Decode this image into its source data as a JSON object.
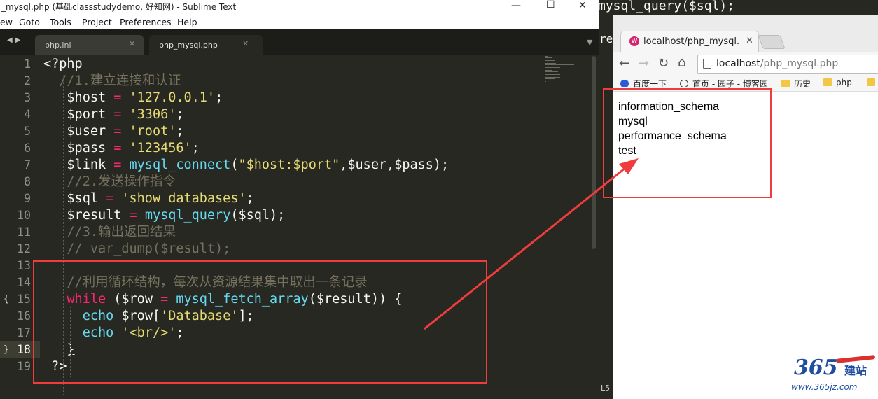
{
  "sublime": {
    "title": "_mysql.php (基础classstudydemo, 好知网) - Sublime Text",
    "menu": [
      "ew",
      "Goto",
      "Tools",
      "Project",
      "Preferences",
      "Help"
    ],
    "tabs": [
      {
        "label": "php.ini",
        "active": false
      },
      {
        "label": "php_mysql.php",
        "active": true
      }
    ],
    "current_line": 18,
    "lines": [
      {
        "n": "1",
        "tokens": [
          {
            "t": "<?php",
            "c": "plain"
          }
        ]
      },
      {
        "n": "2",
        "tokens": [
          {
            "t": "  //1.建立连接和认证",
            "c": "cm"
          }
        ]
      },
      {
        "n": "3",
        "tokens": [
          {
            "t": "   $host ",
            "c": "plain"
          },
          {
            "t": "=",
            "c": "kw"
          },
          {
            "t": " ",
            "c": "plain"
          },
          {
            "t": "'127.0.0.1'",
            "c": "str"
          },
          {
            "t": ";",
            "c": "plain"
          }
        ]
      },
      {
        "n": "4",
        "tokens": [
          {
            "t": "   $port ",
            "c": "plain"
          },
          {
            "t": "=",
            "c": "kw"
          },
          {
            "t": " ",
            "c": "plain"
          },
          {
            "t": "'3306'",
            "c": "str"
          },
          {
            "t": ";",
            "c": "plain"
          }
        ]
      },
      {
        "n": "5",
        "tokens": [
          {
            "t": "   $user ",
            "c": "plain"
          },
          {
            "t": "=",
            "c": "kw"
          },
          {
            "t": " ",
            "c": "plain"
          },
          {
            "t": "'root'",
            "c": "str"
          },
          {
            "t": ";",
            "c": "plain"
          }
        ]
      },
      {
        "n": "6",
        "tokens": [
          {
            "t": "   $pass ",
            "c": "plain"
          },
          {
            "t": "=",
            "c": "kw"
          },
          {
            "t": " ",
            "c": "plain"
          },
          {
            "t": "'123456'",
            "c": "str"
          },
          {
            "t": ";",
            "c": "plain"
          }
        ]
      },
      {
        "n": "7",
        "tokens": [
          {
            "t": "   $link ",
            "c": "plain"
          },
          {
            "t": "=",
            "c": "kw"
          },
          {
            "t": " ",
            "c": "plain"
          },
          {
            "t": "mysql_connect",
            "c": "fn"
          },
          {
            "t": "(",
            "c": "plain"
          },
          {
            "t": "\"$host:$port\"",
            "c": "str"
          },
          {
            "t": ",$user,$pass);",
            "c": "plain"
          }
        ]
      },
      {
        "n": "8",
        "tokens": [
          {
            "t": "   //2.发送操作指令",
            "c": "cm"
          }
        ]
      },
      {
        "n": "9",
        "tokens": [
          {
            "t": "   $sql ",
            "c": "plain"
          },
          {
            "t": "=",
            "c": "kw"
          },
          {
            "t": " ",
            "c": "plain"
          },
          {
            "t": "'show databases'",
            "c": "str"
          },
          {
            "t": ";",
            "c": "plain"
          }
        ]
      },
      {
        "n": "10",
        "tokens": [
          {
            "t": "   $result ",
            "c": "plain"
          },
          {
            "t": "=",
            "c": "kw"
          },
          {
            "t": " ",
            "c": "plain"
          },
          {
            "t": "mysql_query",
            "c": "fn"
          },
          {
            "t": "($sql);",
            "c": "plain"
          }
        ]
      },
      {
        "n": "11",
        "tokens": [
          {
            "t": "   //3.输出返回结果",
            "c": "cm"
          }
        ]
      },
      {
        "n": "12",
        "tokens": [
          {
            "t": "   // var_dump($result);",
            "c": "cm"
          }
        ]
      },
      {
        "n": "13",
        "tokens": []
      },
      {
        "n": "14",
        "tokens": [
          {
            "t": "   //利用循环结构，每次从资源结果集中取出一条记录",
            "c": "cm"
          }
        ]
      },
      {
        "n": "15",
        "tokens": [
          {
            "t": "   ",
            "c": "plain"
          },
          {
            "t": "while",
            "c": "kw"
          },
          {
            "t": " ($row ",
            "c": "plain"
          },
          {
            "t": "=",
            "c": "kw"
          },
          {
            "t": " ",
            "c": "plain"
          },
          {
            "t": "mysql_fetch_array",
            "c": "fn"
          },
          {
            "t": "($result)) ",
            "c": "plain"
          },
          {
            "t": "{",
            "c": "ul"
          }
        ]
      },
      {
        "n": "16",
        "tokens": [
          {
            "t": "     ",
            "c": "plain"
          },
          {
            "t": "echo",
            "c": "fn"
          },
          {
            "t": " $row[",
            "c": "plain"
          },
          {
            "t": "'Database'",
            "c": "str"
          },
          {
            "t": "];",
            "c": "plain"
          }
        ]
      },
      {
        "n": "17",
        "tokens": [
          {
            "t": "     ",
            "c": "plain"
          },
          {
            "t": "echo",
            "c": "fn"
          },
          {
            "t": " ",
            "c": "plain"
          },
          {
            "t": "'<br/>'",
            "c": "str"
          },
          {
            "t": ";",
            "c": "plain"
          }
        ]
      },
      {
        "n": "18",
        "tokens": [
          {
            "t": "   ",
            "c": "plain"
          },
          {
            "t": "}",
            "c": "ul"
          }
        ]
      },
      {
        "n": "19",
        "tokens": [
          {
            "t": " ?>",
            "c": "plain"
          }
        ]
      }
    ],
    "top_peek": "mysql_query($sql);",
    "status_peek": "L5"
  },
  "browser": {
    "tab_title": "localhost/php_mysql.ph",
    "favicon_letter": "W",
    "url_host": "localhost",
    "url_path": "/php_mysql.php",
    "bookmarks": [
      "百度一下",
      "首页 - 园子 - 博客园",
      "历史",
      "php"
    ],
    "output": [
      "information_schema",
      "mysql",
      "performance_schema",
      "test"
    ]
  },
  "watermark": {
    "logo_number": "365",
    "logo_cn": "建站",
    "site": "www.365jz.com"
  },
  "colors": {
    "editor_bg": "#272822",
    "keyword": "#f92672",
    "string": "#e6db74",
    "function": "#66d9ef",
    "comment": "#75715e",
    "annotation_red": "#f03c3c"
  }
}
